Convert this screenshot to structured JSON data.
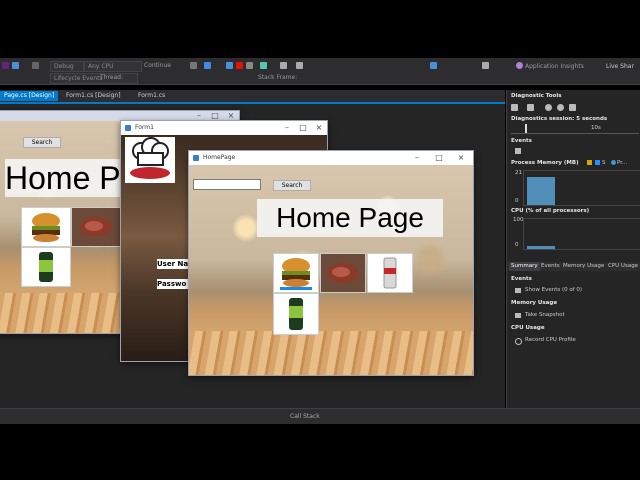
{
  "toolbar": {
    "config": "Debug",
    "platform": "Any CPU",
    "continue_label": "Continue",
    "lifecycle": "Lifecycle Events",
    "thread": "Thread:",
    "stack_frame": "Stack Frame:",
    "insights": "Application Insights",
    "live_share": "Live Shar"
  },
  "tabs": [
    {
      "label": "Page.cs [Design]"
    },
    {
      "label": "Form1.cs [Design]"
    },
    {
      "label": "Form1.cs"
    }
  ],
  "bg_window": {
    "search_label": "Search",
    "heading": "Home P"
  },
  "form1": {
    "title": "Form1",
    "user_label": "User Na",
    "pass_label": "Passwo"
  },
  "homepage": {
    "title": "HomePage",
    "search_placeholder": "",
    "search_label": "Search",
    "heading": "Home Page",
    "items": [
      "burger",
      "steak",
      "soda-can",
      "green-bottle"
    ]
  },
  "diagnostics": {
    "title": "Diagnostic Tools",
    "session": "Diagnostics session: 5 seconds",
    "timeline_tick": "10s",
    "events": "Events",
    "process_memory": "Process Memory (MB)",
    "legend_s": "S",
    "legend_pr": "Pr...",
    "mem_max": "21",
    "mem_min": "0",
    "cpu_header": "CPU (% of all processors)",
    "cpu_max": "100",
    "cpu_min": "0",
    "tabs": [
      "Summary",
      "Events",
      "Memory Usage",
      "CPU Usage"
    ],
    "events_section": "Events",
    "show_events": "Show Events (0 of 0)",
    "memory_section": "Memory Usage",
    "take_snapshot": "Take Snapshot",
    "cpu_section": "CPU Usage",
    "record_cpu": "Record CPU Profile"
  },
  "status": {
    "call_stack": "Call Stack"
  },
  "colors": {
    "accent": "#007acc",
    "vs_bg": "#2d2d30"
  }
}
